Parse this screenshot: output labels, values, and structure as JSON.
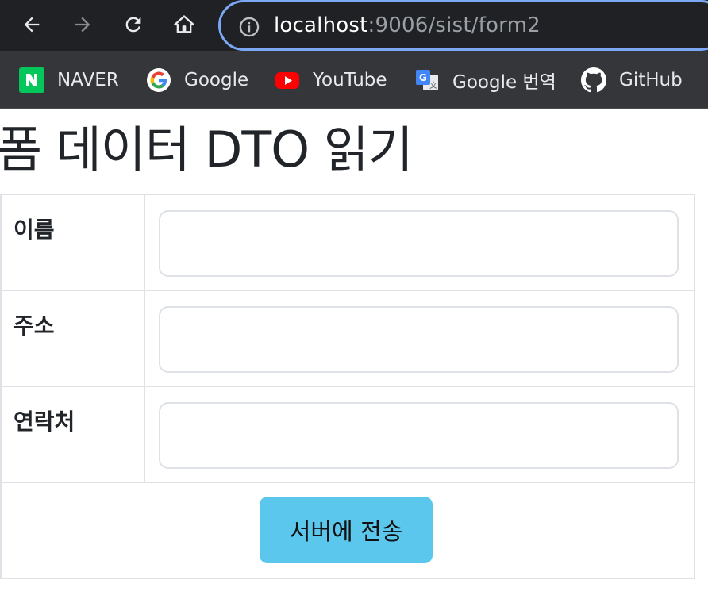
{
  "browser": {
    "url_host": "localhost",
    "url_rest": ":9006/sist/form2",
    "bookmarks": [
      {
        "label": "NAVER",
        "icon": "naver-icon"
      },
      {
        "label": "Google",
        "icon": "google-icon"
      },
      {
        "label": "YouTube",
        "icon": "youtube-icon"
      },
      {
        "label": "Google 번역",
        "icon": "google-translate-icon"
      },
      {
        "label": "GitHub",
        "icon": "github-icon"
      }
    ]
  },
  "page": {
    "title": "폼 데이터 DTO 읽기",
    "fields": [
      {
        "label": "이름",
        "value": ""
      },
      {
        "label": "주소",
        "value": ""
      },
      {
        "label": "연락처",
        "value": ""
      }
    ],
    "submit_label": "서버에 전송"
  },
  "colors": {
    "button": "#5bc7ec",
    "border": "#dee2e6",
    "omnibox_focus": "#7ba7f5"
  }
}
